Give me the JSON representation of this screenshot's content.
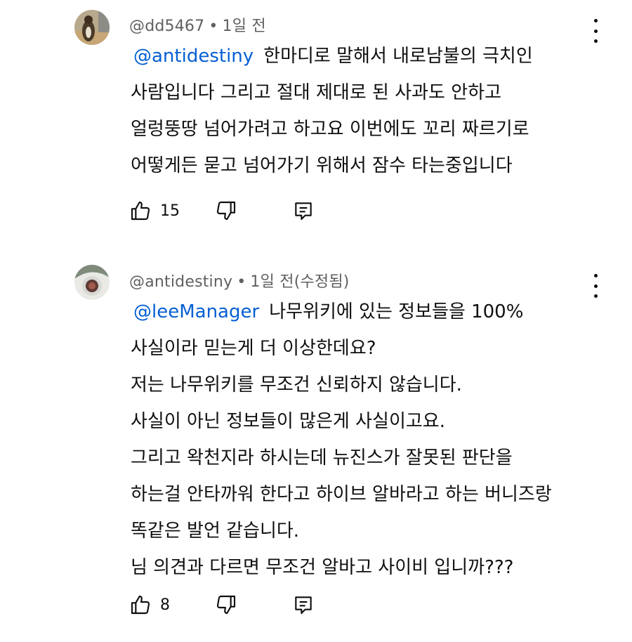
{
  "comments": [
    {
      "author": "@dd5467",
      "time": "1일 전",
      "mention": "@antidestiny",
      "lines": [
        "한마디로 말해서 내로남불의 극치인",
        "사람입니다 그리고 절대 제대로 된 사과도 안하고",
        "얼렁뚱땅 넘어가려고 하고요 이번에도 꼬리 짜르기로",
        "어떻게든 묻고 넘어가기 위해서 잠수 타는중입니다"
      ],
      "likes": "15",
      "icons": {
        "avatar": "avatar-icon",
        "like": "thumbs-up-icon",
        "dislike": "thumbs-down-icon",
        "reply": "reply-icon",
        "menu": "more-vertical-icon"
      }
    },
    {
      "author": "@antidestiny",
      "time": "1일 전(수정됨)",
      "mention": "@leeManager",
      "lines": [
        "나무위키에 있는 정보들을 100%",
        "사실이라 믿는게 더 이상한데요?",
        "저는 나무위키를 무조건 신뢰하지 않습니다.",
        "사실이 아닌 정보들이 많은게 사실이고요.",
        "그리고 왁천지라 하시는데 뉴진스가 잘못된 판단을",
        "하는걸 안타까워 한다고 하이브 알바라고 하는 버니즈랑",
        "똑같은 발언 같습니다.",
        "님 의견과 다르면 무조건 알바고 사이비 입니까???"
      ],
      "likes": "8",
      "icons": {
        "avatar": "avatar-icon",
        "like": "thumbs-up-icon",
        "dislike": "thumbs-down-icon",
        "reply": "reply-icon",
        "menu": "more-vertical-icon"
      }
    }
  ],
  "colors": {
    "text": "#0f0f0f",
    "meta": "#606060",
    "mention": "#065fd4",
    "background": "#ffffff"
  }
}
